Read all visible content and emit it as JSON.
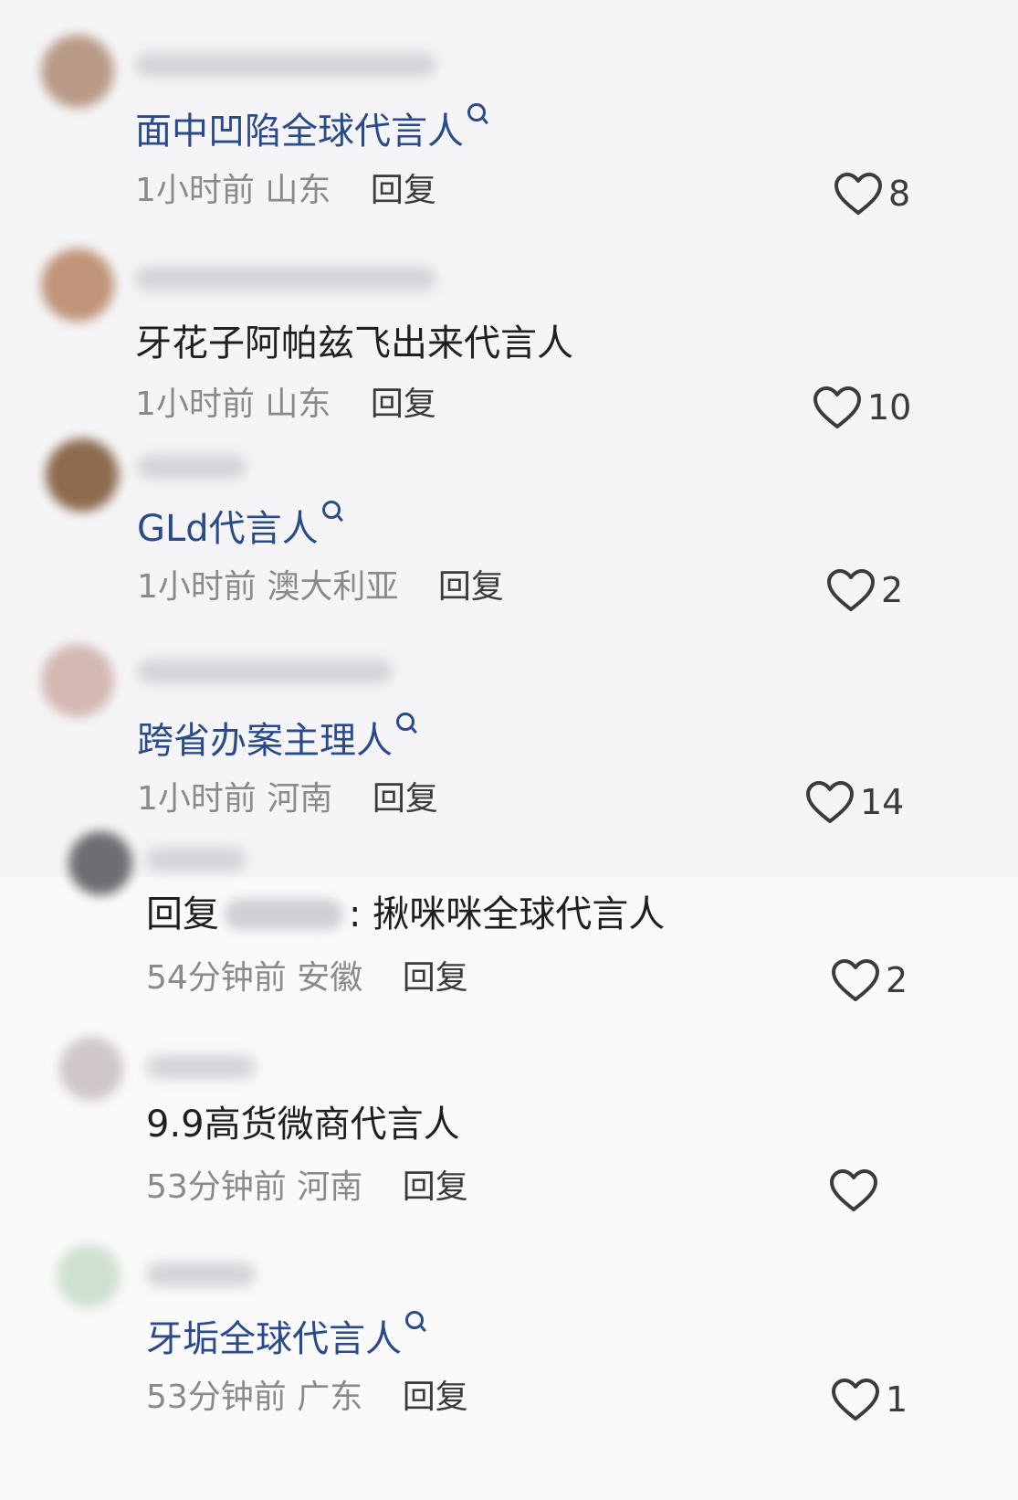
{
  "comments": [
    {
      "text": "面中凹陷全球代言人",
      "is_link": true,
      "time": "1小时前",
      "location": "山东",
      "reply_label": "回复",
      "likes": "8",
      "avatar_color": "#b89a86"
    },
    {
      "text": "牙花子阿帕兹飞出来代言人",
      "is_link": false,
      "time": "1小时前",
      "location": "山东",
      "reply_label": "回复",
      "likes": "10",
      "avatar_color": "#c09478"
    },
    {
      "text": "GLd代言人",
      "is_link": true,
      "time": "1小时前",
      "location": "澳大利亚",
      "reply_label": "回复",
      "likes": "2",
      "avatar_color": "#8c6a4e"
    },
    {
      "text": "跨省办案主理人",
      "is_link": true,
      "time": "1小时前",
      "location": "河南",
      "reply_label": "回复",
      "likes": "14",
      "avatar_color": "#d4b8b2"
    },
    {
      "reply_prefix": "回复",
      "text": ": 揪咪咪全球代言人",
      "is_link": false,
      "time": "54分钟前",
      "location": "安徽",
      "reply_label": "回复",
      "likes": "2",
      "avatar_color": "#6e6e72"
    },
    {
      "text": "9.9高货微商代言人",
      "is_link": false,
      "time": "53分钟前",
      "location": "河南",
      "reply_label": "回复",
      "likes": "",
      "avatar_color": "#cfc7cc"
    },
    {
      "text": "牙垢全球代言人",
      "is_link": true,
      "time": "53分钟前",
      "location": "广东",
      "reply_label": "回复",
      "likes": "1",
      "avatar_color": "#cfe0d0"
    }
  ],
  "icons": {
    "like": "heart-outline-icon",
    "search": "search-icon"
  },
  "colors": {
    "link_text": "#2a4a8a",
    "meta_text": "#8a8a8e",
    "body_text": "#1f1f1f"
  }
}
